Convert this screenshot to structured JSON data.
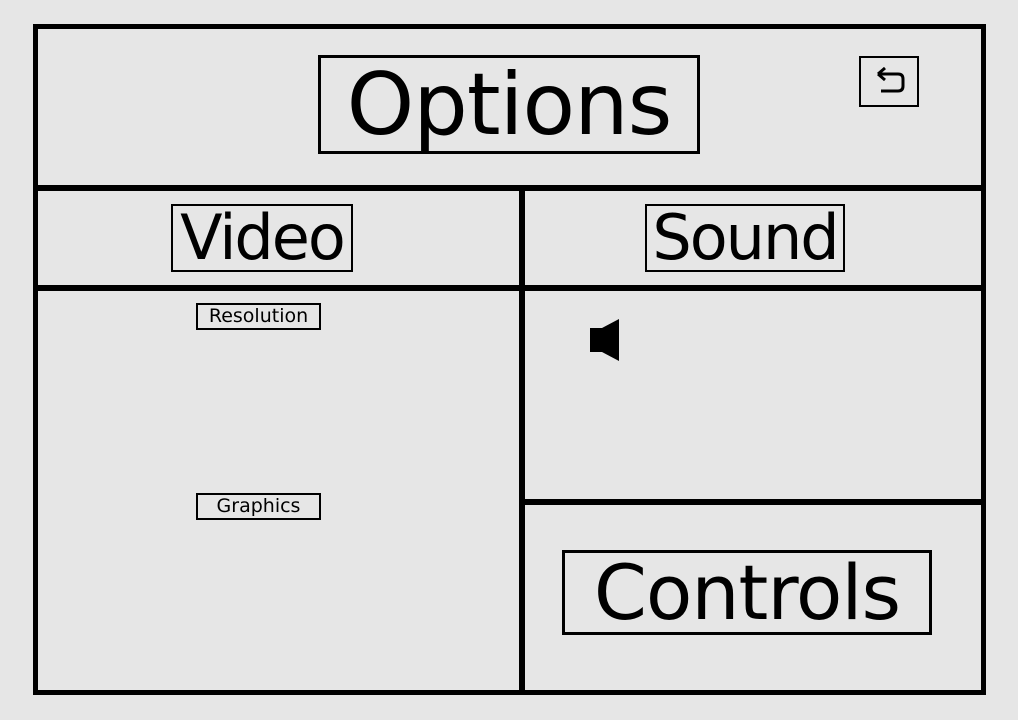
{
  "header": {
    "title": "Options",
    "back_icon": "undo-arrow-icon"
  },
  "tabs": [
    {
      "label": "Video"
    },
    {
      "label": "Sound"
    }
  ],
  "video": {
    "resolution_label": "Resolution",
    "graphics_label": "Graphics"
  },
  "sound": {
    "volume_icon": "speaker-icon"
  },
  "controls": {
    "label": "Controls"
  }
}
